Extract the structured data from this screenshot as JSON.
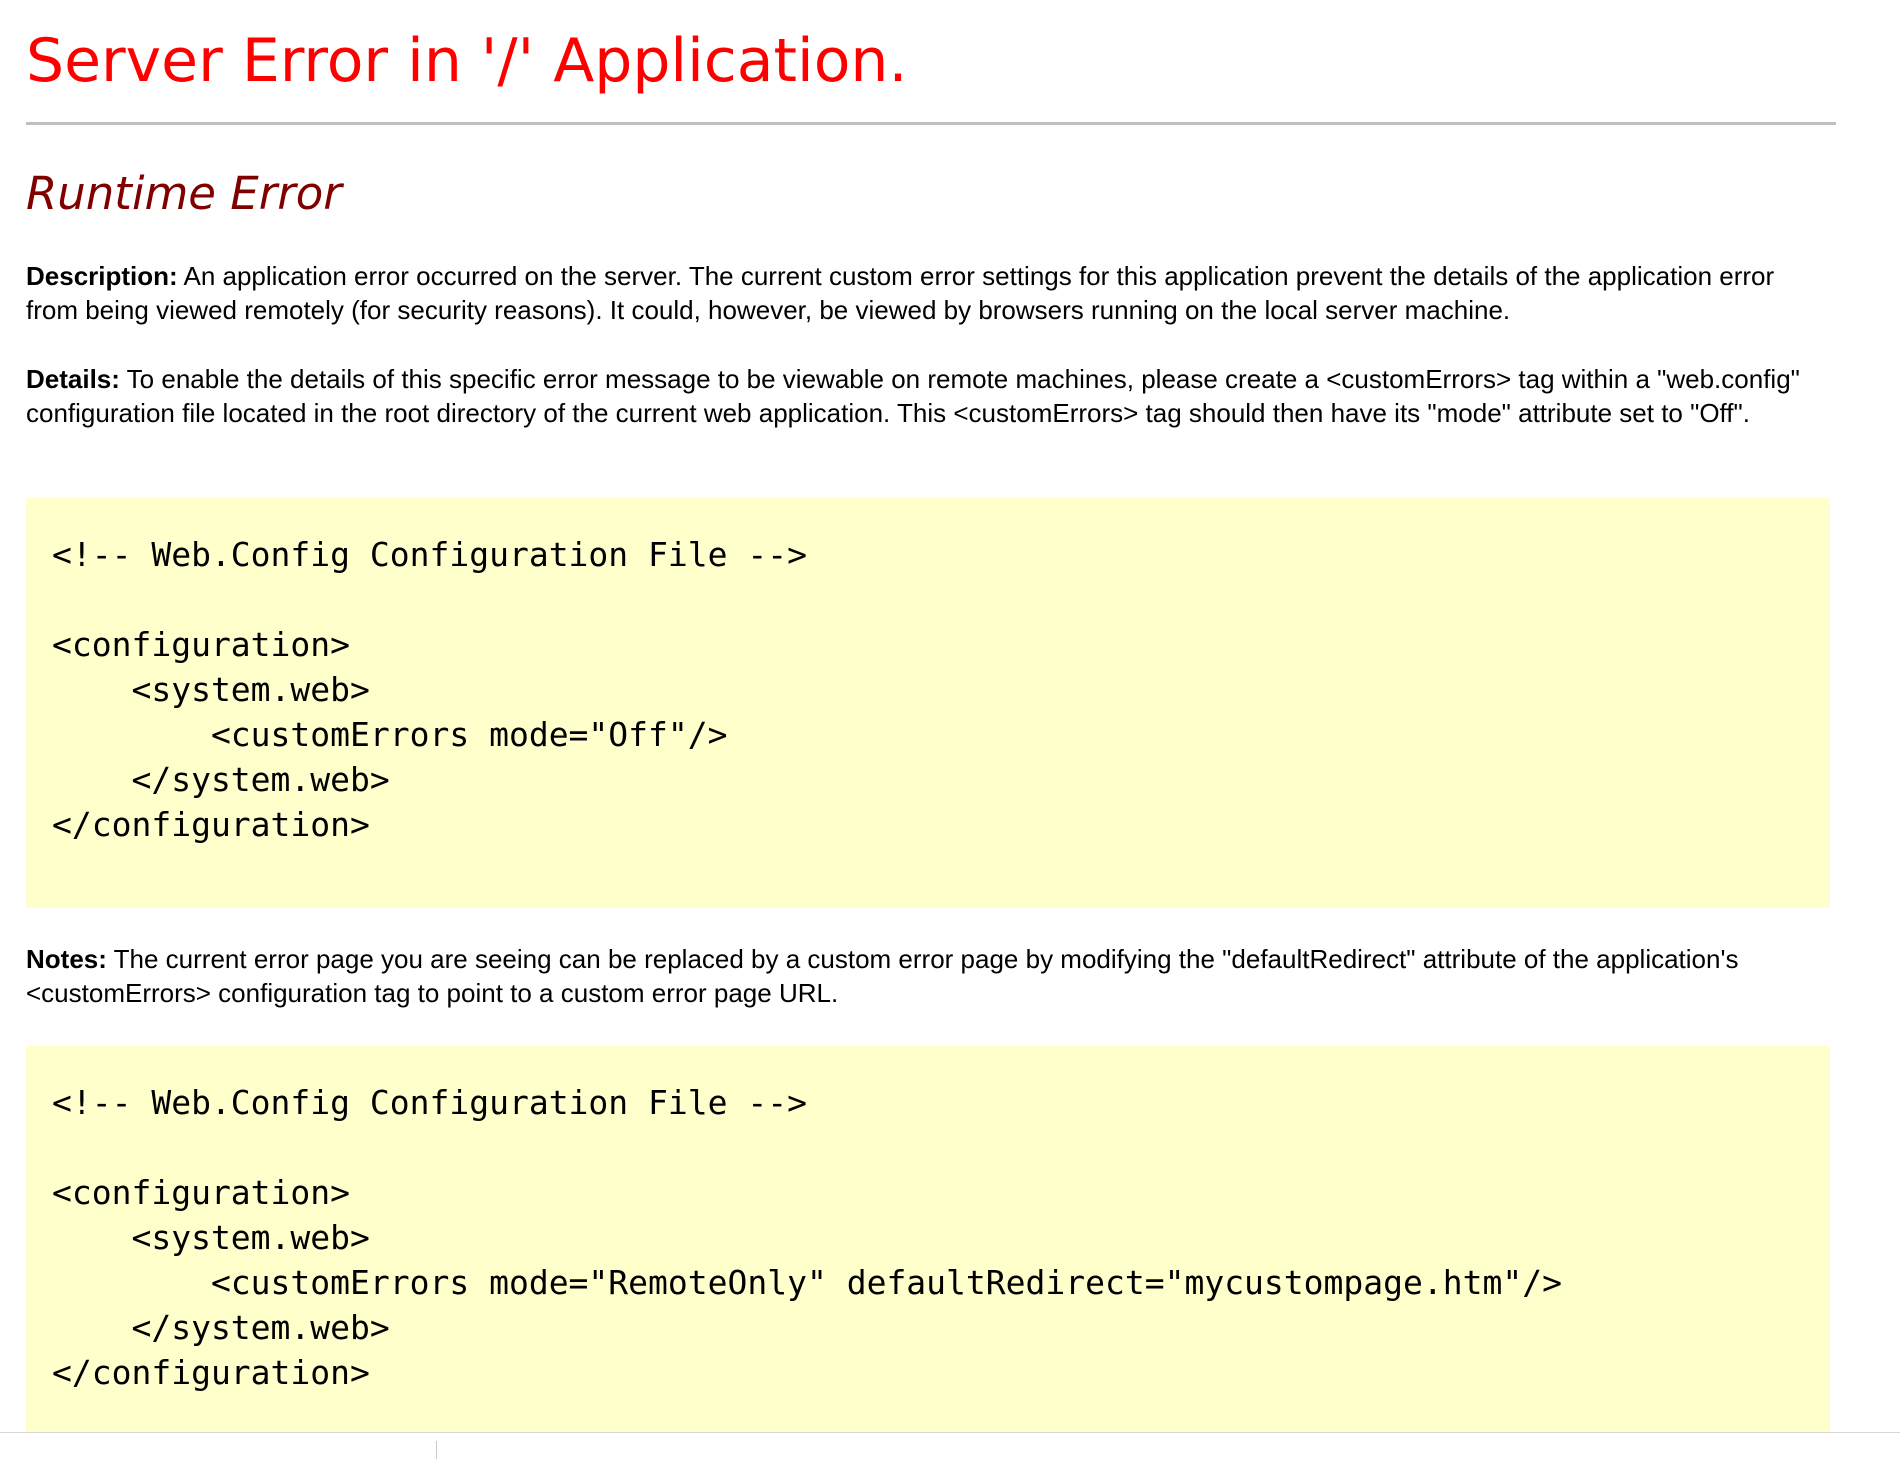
{
  "page": {
    "title": "Server Error in '/' Application.",
    "subtitle": "Runtime Error"
  },
  "description": {
    "label": "Description:",
    "text": " An application error occurred on the server. The current custom error settings for this application prevent the details of the application error from being viewed remotely (for security reasons). It could, however, be viewed by browsers running on the local server machine."
  },
  "details": {
    "label": "Details:",
    "text": " To enable the details of this specific error message to be viewable on remote machines, please create a <customErrors> tag within a \"web.config\" configuration file located in the root directory of the current web application. This <customErrors> tag should then have its \"mode\" attribute set to \"Off\"."
  },
  "code_block_1": {
    "code": "<!-- Web.Config Configuration File -->\n\n<configuration>\n    <system.web>\n        <customErrors mode=\"Off\"/>\n    </system.web>\n</configuration>"
  },
  "notes": {
    "label": "Notes:",
    "text": " The current error page you are seeing can be replaced by a custom error page by modifying the \"defaultRedirect\" attribute of the application's <customErrors> configuration tag to point to a custom error page URL."
  },
  "code_block_2": {
    "code": "<!-- Web.Config Configuration File -->\n\n<configuration>\n    <system.web>\n        <customErrors mode=\"RemoteOnly\" defaultRedirect=\"mycustompage.htm\"/>\n    </system.web>\n</configuration>"
  },
  "colors": {
    "title": "#ff0000",
    "subtitle": "#800000",
    "code_background": "#ffffcc",
    "rule": "#c0c0c0"
  }
}
